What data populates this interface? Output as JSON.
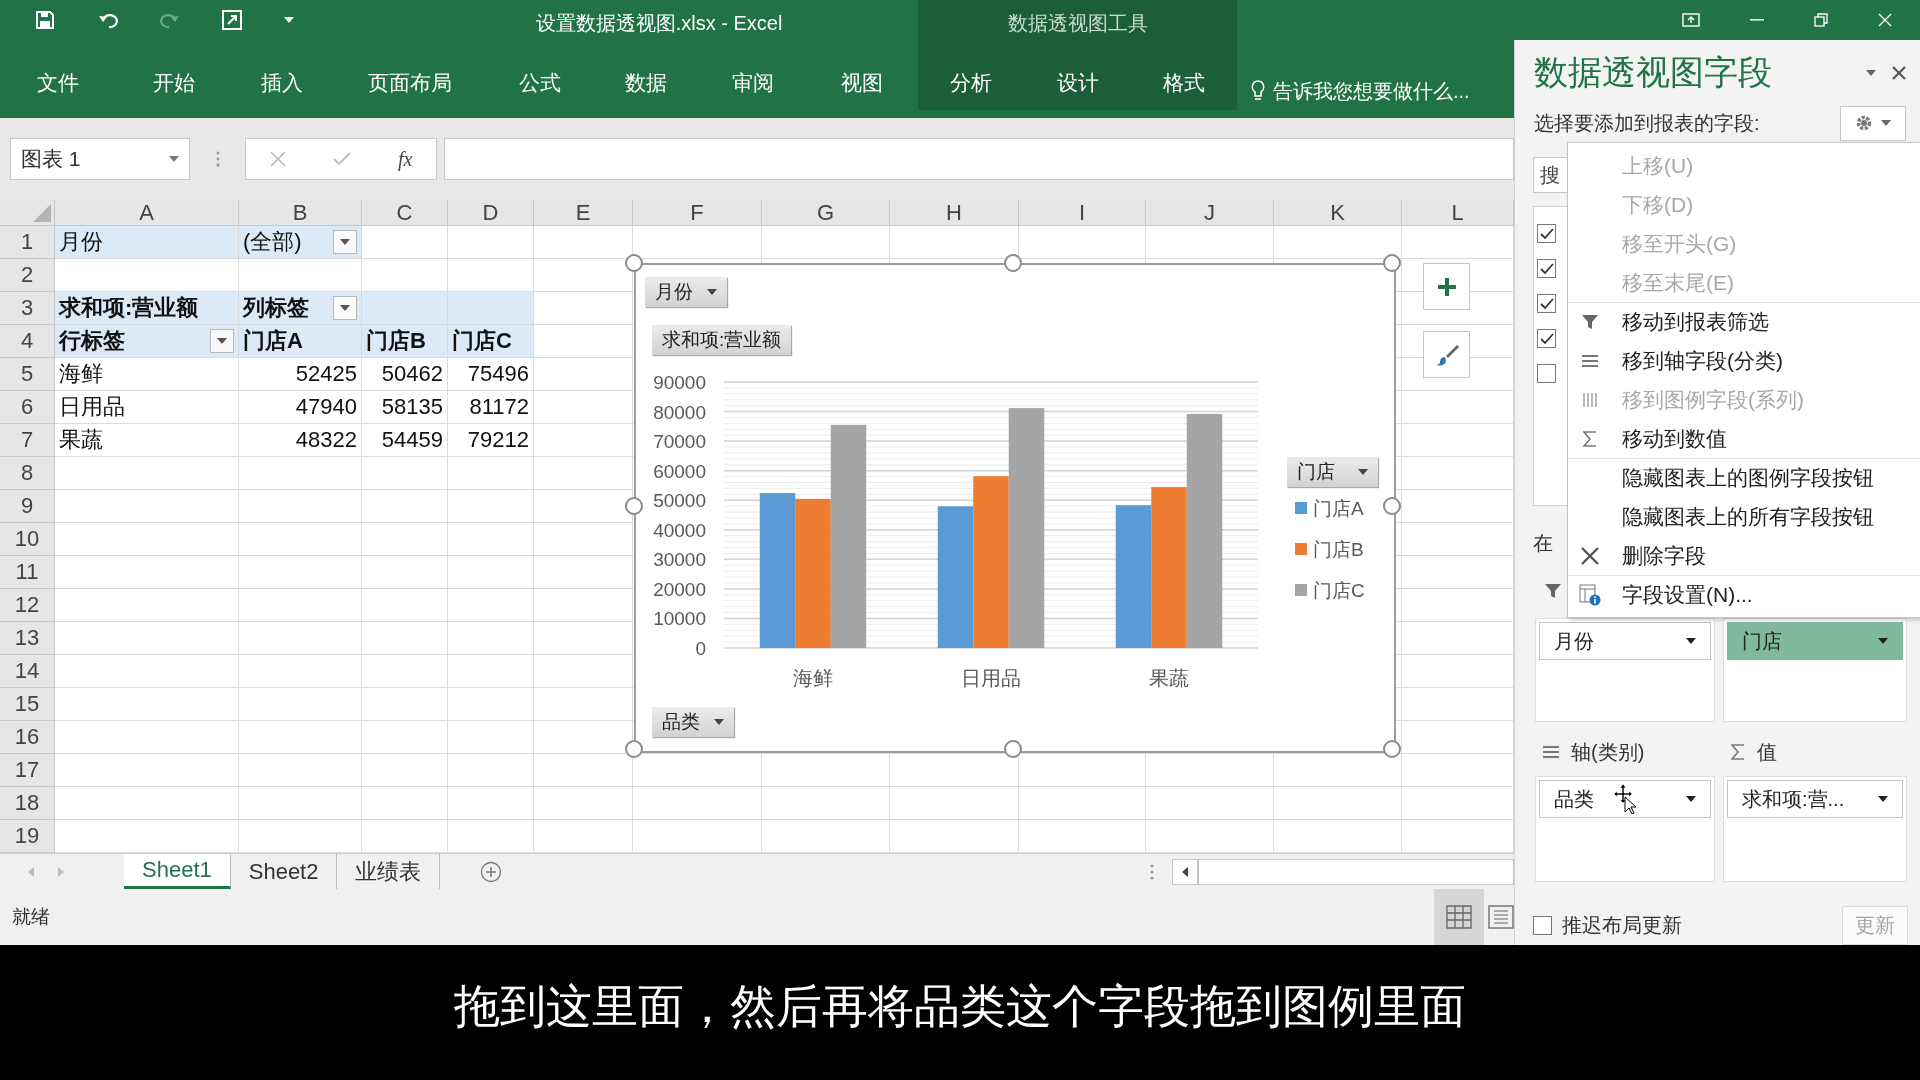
{
  "title_bar": {
    "title": "设置数据透视图.xlsx - Excel",
    "context_title": "数据透视图工具"
  },
  "ribbon": {
    "tabs": [
      {
        "label": "文件"
      },
      {
        "label": "开始"
      },
      {
        "label": "插入"
      },
      {
        "label": "页面布局"
      },
      {
        "label": "公式"
      },
      {
        "label": "数据"
      },
      {
        "label": "审阅"
      },
      {
        "label": "视图"
      }
    ],
    "context_tabs": [
      {
        "label": "分析"
      },
      {
        "label": "设计"
      },
      {
        "label": "格式"
      }
    ],
    "tell_me": "告诉我您想要做什么..."
  },
  "formula_bar": {
    "name_box": "图表 1",
    "function_label": "fx"
  },
  "sheet": {
    "columns": [
      "A",
      "B",
      "C",
      "D",
      "E",
      "F",
      "G",
      "H",
      "I",
      "J",
      "K",
      "L"
    ],
    "rows": [
      {
        "number": "1",
        "cells": [
          {
            "text": "月份",
            "kind": "label",
            "highlight": true,
            "dropdown": false
          },
          {
            "text": "(全部)",
            "kind": "label",
            "highlight": true,
            "dropdown": true
          }
        ]
      },
      {
        "number": "2"
      },
      {
        "number": "3",
        "cells": [
          {
            "text": "求和项:营业额",
            "kind": "header",
            "highlight": true,
            "dropdown": false
          },
          {
            "text": "列标签",
            "kind": "header",
            "highlight": true,
            "dropdown": true
          },
          {
            "kind": "blank",
            "highlight": true,
            "dropdown": false
          },
          {
            "kind": "blank",
            "highlight": true,
            "dropdown": false
          }
        ]
      },
      {
        "number": "4",
        "cells": [
          {
            "text": "行标签",
            "kind": "header",
            "highlight": true,
            "dropdown": true
          },
          {
            "text": "门店A",
            "kind": "header",
            "highlight": true,
            "dropdown": false
          },
          {
            "text": "门店B",
            "kind": "header",
            "highlight": true,
            "dropdown": false
          },
          {
            "text": "门店C",
            "kind": "header",
            "highlight": true,
            "dropdown": false
          }
        ]
      },
      {
        "number": "5",
        "cells": [
          {
            "text": "海鲜",
            "kind": "label",
            "highlight": false,
            "dropdown": false
          },
          {
            "text": "52425",
            "kind": "number",
            "highlight": false,
            "dropdown": false
          },
          {
            "text": "50462",
            "kind": "number",
            "highlight": false,
            "dropdown": false
          },
          {
            "text": "75496",
            "kind": "number",
            "highlight": false,
            "dropdown": false
          }
        ]
      },
      {
        "number": "6",
        "cells": [
          {
            "text": "日用品",
            "kind": "label",
            "highlight": false,
            "dropdown": false
          },
          {
            "text": "47940",
            "kind": "number",
            "highlight": false,
            "dropdown": false
          },
          {
            "text": "58135",
            "kind": "number",
            "highlight": false,
            "dropdown": false
          },
          {
            "text": "81172",
            "kind": "number",
            "highlight": false,
            "dropdown": false
          }
        ]
      },
      {
        "number": "7",
        "cells": [
          {
            "text": "果蔬",
            "kind": "label",
            "highlight": false,
            "dropdown": false
          },
          {
            "text": "48322",
            "kind": "number",
            "highlight": false,
            "dropdown": false
          },
          {
            "text": "54459",
            "kind": "number",
            "highlight": false,
            "dropdown": false
          },
          {
            "text": "79212",
            "kind": "number",
            "highlight": false,
            "dropdown": false
          }
        ]
      },
      {
        "number": "8"
      },
      {
        "number": "9"
      },
      {
        "number": "10"
      },
      {
        "number": "11"
      },
      {
        "number": "12"
      },
      {
        "number": "13"
      },
      {
        "number": "14"
      },
      {
        "number": "15"
      },
      {
        "number": "16"
      },
      {
        "number": "17"
      },
      {
        "number": "18"
      },
      {
        "number": "19"
      }
    ]
  },
  "chart": {
    "filter_button": "月份",
    "value_button": "求和项:营业额",
    "axis_button": "品类",
    "legend_button": "门店",
    "chart_data": {
      "type": "bar",
      "categories": [
        "海鲜",
        "日用品",
        "果蔬"
      ],
      "series": [
        {
          "name": "门店A",
          "color": "#5b9bd5",
          "values": [
            52425,
            47940,
            48322
          ]
        },
        {
          "name": "门店B",
          "color": "#ed7d31",
          "values": [
            50462,
            58135,
            54459
          ]
        },
        {
          "name": "门店C",
          "color": "#a5a5a5",
          "values": [
            75496,
            81172,
            79212
          ]
        }
      ],
      "grid": true,
      "legend": true,
      "ylim": [
        0,
        90000
      ],
      "yticks": [
        0,
        10000,
        20000,
        30000,
        40000,
        50000,
        60000,
        70000,
        80000,
        90000
      ]
    }
  },
  "sheet_tabs": [
    {
      "label": "Sheet1",
      "selected": true
    },
    {
      "label": "Sheet2",
      "selected": false
    },
    {
      "label": "业绩表",
      "selected": false
    }
  ],
  "status": "就绪",
  "pane": {
    "title": "数据透视图字段",
    "subtitle": "选择要添加到报表的字段:",
    "search": {
      "placeholder": "搜"
    },
    "fields": [
      {
        "checked": true
      },
      {
        "checked": true
      },
      {
        "checked": true
      },
      {
        "checked": true
      },
      {
        "checked": false
      }
    ],
    "areas_label": "在",
    "filter_items": [
      {
        "label": "月份",
        "selected": false
      }
    ],
    "legend_items": [
      {
        "label": "门店",
        "selected": true
      }
    ],
    "axis_header": "轴(类别)",
    "values_header": "值",
    "axis_items": [
      {
        "label": "品类",
        "selected": false
      }
    ],
    "value_items": [
      {
        "label": "求和项:营...",
        "selected": false
      }
    ],
    "defer": {
      "label": "推迟布局更新",
      "checked": false
    },
    "update_button": "更新"
  },
  "menu": [
    {
      "label": "上移(U)",
      "kind": "plain",
      "disabled": true,
      "divider_above": false
    },
    {
      "label": "下移(D)",
      "kind": "plain",
      "disabled": true,
      "divider_above": false
    },
    {
      "label": "移至开头(G)",
      "kind": "plain",
      "disabled": true,
      "divider_above": false
    },
    {
      "label": "移至末尾(E)",
      "kind": "plain",
      "disabled": true,
      "divider_above": false
    },
    {
      "label": "移动到报表筛选",
      "kind": "filter",
      "disabled": false,
      "divider_above": true
    },
    {
      "label": "移到轴字段(分类)",
      "kind": "axis",
      "disabled": false,
      "divider_above": false
    },
    {
      "label": "移到图例字段(系列)",
      "kind": "legend",
      "disabled": true,
      "divider_above": false
    },
    {
      "label": "移动到数值",
      "kind": "sum",
      "disabled": false,
      "divider_above": false
    },
    {
      "label": "隐藏图表上的图例字段按钮",
      "kind": "plain",
      "disabled": false,
      "divider_above": true
    },
    {
      "label": "隐藏图表上的所有字段按钮",
      "kind": "plain",
      "disabled": false,
      "divider_above": false
    },
    {
      "label": "删除字段",
      "kind": "delete",
      "disabled": false,
      "divider_above": false
    },
    {
      "label": "字段设置(N)...",
      "kind": "settings",
      "disabled": false,
      "divider_above": true
    }
  ],
  "subtitle": "拖到这里面，然后再将品类这个字段拖到图例里面"
}
